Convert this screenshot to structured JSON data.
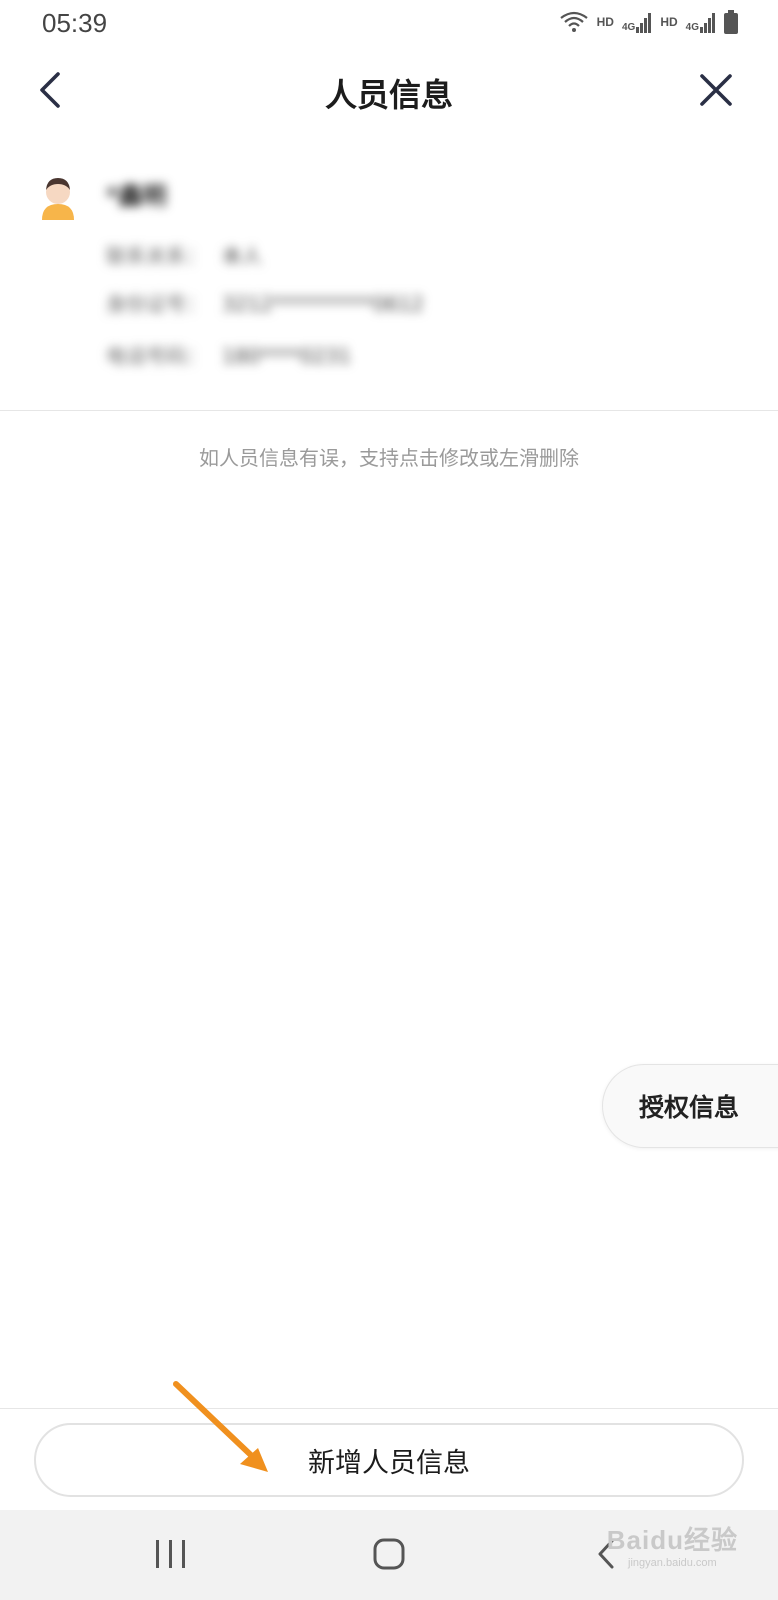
{
  "status_bar": {
    "time": "05:39",
    "network_labels": [
      "HD",
      "4G",
      "HD",
      "4G"
    ],
    "icons": [
      "wifi-icon",
      "signal-icon",
      "signal-icon",
      "battery-icon"
    ]
  },
  "nav": {
    "title": "人员信息",
    "back_icon": "chevron-left-icon",
    "close_icon": "close-icon"
  },
  "person": {
    "name": "*鑫明",
    "avatar_icon": "person-avatar-icon",
    "fields": [
      {
        "label": "联系关系：",
        "value": "本人"
      },
      {
        "label": "身份证号：",
        "value": "3212**********0612"
      },
      {
        "label": "电话号码：",
        "value": "180****0231"
      }
    ]
  },
  "hint": "如人员信息有误，支持点击修改或左滑删除",
  "auth_button": "授权信息",
  "add_button": "新增人员信息",
  "system_nav": {
    "recent_icon": "recent-apps-icon",
    "home_icon": "home-icon",
    "back_icon": "back-icon"
  },
  "watermark": {
    "main": "Baidu经验",
    "sub": "jingyan.baidu.com"
  },
  "colors": {
    "accent_arrow": "#f0901e",
    "text_primary": "#1c1c1c",
    "text_hint": "#9a9a9a",
    "nav_background": "#f2f2f2"
  }
}
